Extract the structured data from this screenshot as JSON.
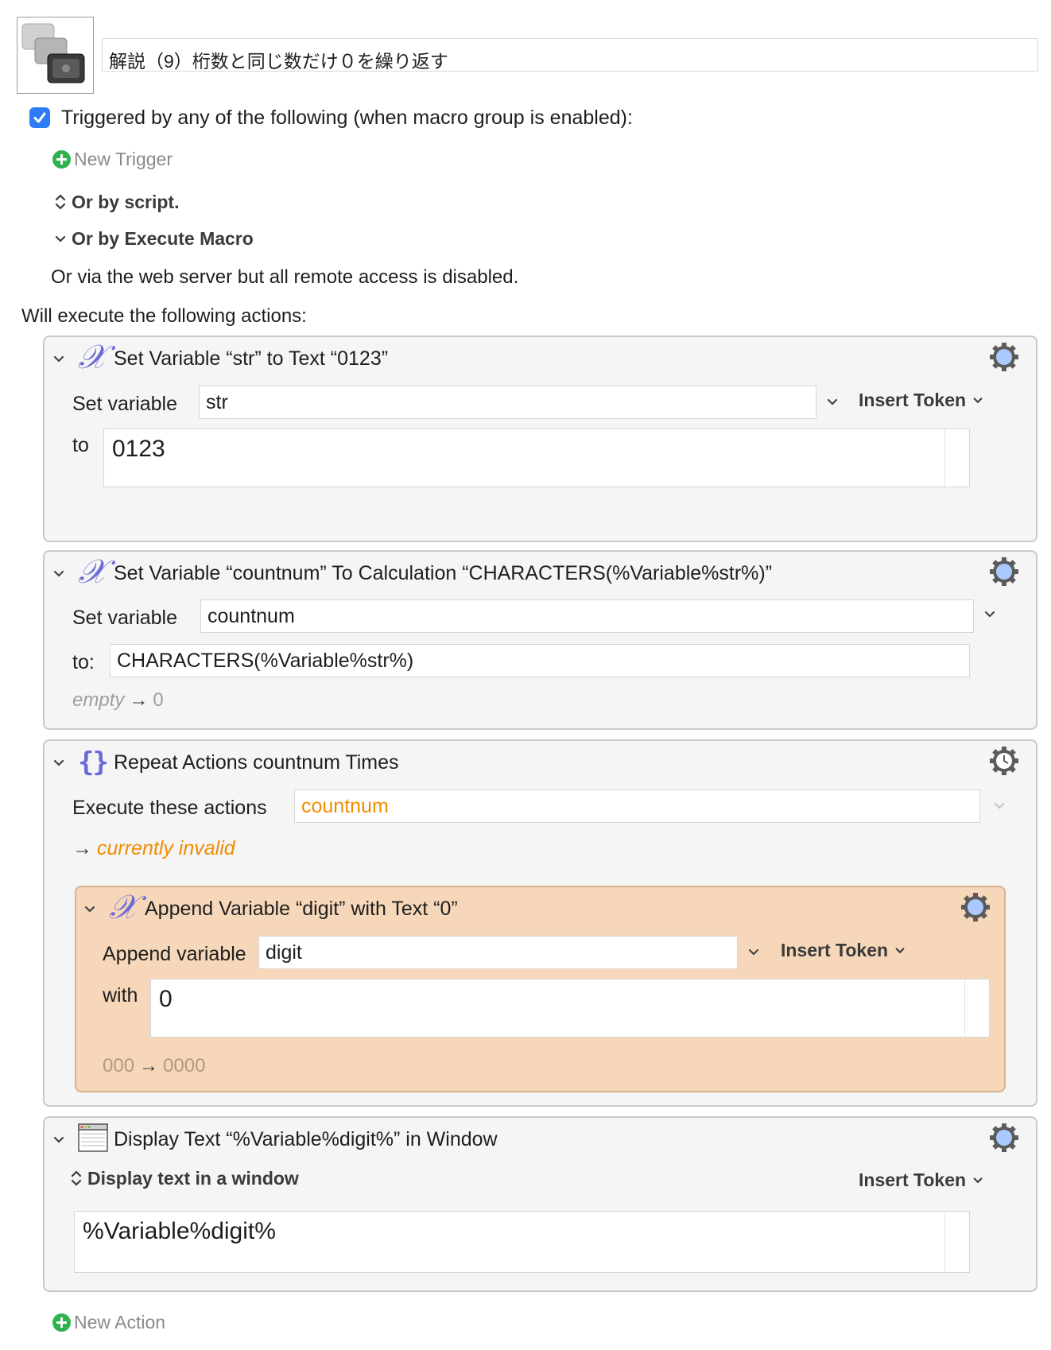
{
  "macro": {
    "title": "解説（9）桁数と同じ数だけ０を繰り返す"
  },
  "triggers": {
    "enabled": true,
    "heading": "Triggered by any of the following (when macro group is enabled):",
    "new_trigger": "New Trigger",
    "or_by_script": "Or by script.",
    "or_by_execute_macro": "Or by Execute Macro",
    "web_server_note": "Or via the web server but all remote access is disabled."
  },
  "actions_heading": "Will execute the following actions:",
  "actions": [
    {
      "title": "Set Variable “str” to Text “0123”",
      "field_label": "Set variable",
      "variable": "str",
      "insert_token": "Insert Token",
      "to_label": "to",
      "text": "0123"
    },
    {
      "title": "Set Variable “countnum” To Calculation “CHARACTERS(%Variable%str%)”",
      "field_label": "Set variable",
      "variable": "countnum",
      "to_label": "to:",
      "calculation": "CHARACTERS(%Variable%str%)",
      "preview_empty": "empty",
      "preview_result": "0"
    },
    {
      "title": "Repeat Actions countnum Times",
      "field_label": "Execute these actions",
      "count": "countnum",
      "status": "currently invalid",
      "nested": {
        "title": "Append Variable “digit” with Text “0”",
        "field_label": "Append variable",
        "variable": "digit",
        "insert_token": "Insert Token",
        "with_label": "with",
        "text": "0",
        "preview_before": "000",
        "preview_after": "0000"
      }
    },
    {
      "title": "Display Text “%Variable%digit%” in Window",
      "mode": "Display text in a window",
      "insert_token": "Insert Token",
      "text": "%Variable%digit%"
    }
  ],
  "new_action": "New Action",
  "colors": {
    "accent_blue": "#2d7cf6",
    "add_green": "#2fb24c",
    "warning_orange": "#f08c00",
    "nested_bg": "#f6d7b9"
  }
}
